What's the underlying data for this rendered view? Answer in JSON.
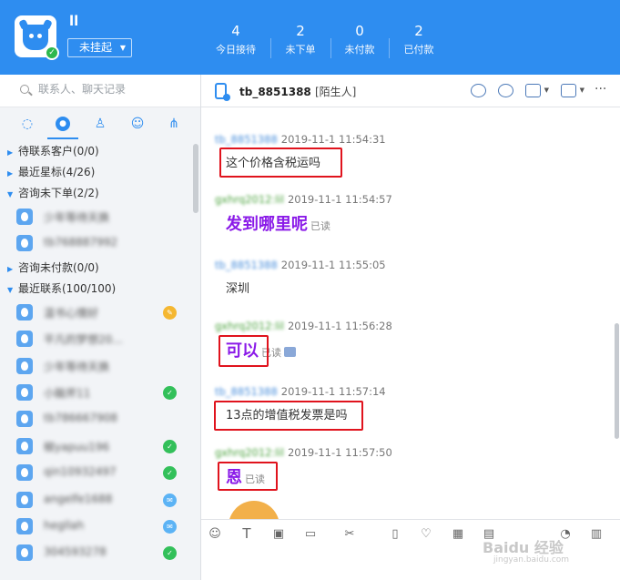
{
  "header": {
    "username": "ll",
    "status_label": "未挂起",
    "stats": [
      {
        "value": "4",
        "label": "今日接待"
      },
      {
        "value": "2",
        "label": "未下单"
      },
      {
        "value": "0",
        "label": "未付款"
      },
      {
        "value": "2",
        "label": "已付款"
      }
    ]
  },
  "sidebar": {
    "search_placeholder": "联系人、聊天记录",
    "tabs": [
      "chat-bubble-icon",
      "clock-icon",
      "person-icon",
      "people-icon",
      "org-chart-icon"
    ],
    "groups": [
      {
        "label": "待联系客户(0/0)",
        "expanded": false,
        "contacts": []
      },
      {
        "label": "最近星标(4/26)",
        "expanded": false,
        "contacts": []
      },
      {
        "label": "咨询未下单(2/2)",
        "expanded": true,
        "contacts": [
          {
            "name": "少年等待天换",
            "badge": ""
          },
          {
            "name": "tb768887992",
            "badge": ""
          }
        ]
      },
      {
        "label": "咨询未付款(0/0)",
        "expanded": false,
        "contacts": []
      },
      {
        "label": "最近联系(100/100)",
        "expanded": true,
        "contacts": [
          {
            "name": "温书心情好",
            "badge": "yellow"
          },
          {
            "name": "平凡的梦想20...",
            "badge": ""
          },
          {
            "name": "少年等待天换",
            "badge": ""
          },
          {
            "name": "小脑斧11",
            "badge": "green"
          },
          {
            "name": "tb786667908",
            "badge": ""
          },
          {
            "name": "椒yapuu196",
            "badge": "green"
          },
          {
            "name": "qin10932497",
            "badge": "green"
          },
          {
            "name": "angelfe1688",
            "badge": "blue"
          },
          {
            "name": "hegllah",
            "badge": "blue"
          },
          {
            "name": "304593278",
            "badge": "green"
          }
        ]
      }
    ]
  },
  "chat": {
    "contact_name": "tb_8851388",
    "contact_tag": "[陌生人]",
    "messages": [
      {
        "sender": "tb_8851388",
        "time": "2019-11-1 11:54:31",
        "text": "这个价格含税运吗",
        "style": "plain",
        "read": ""
      },
      {
        "sender": "gxhrq2012:lil",
        "time": "2019-11-1 11:54:57",
        "text": "发到哪里呢",
        "style": "big",
        "read": "已读"
      },
      {
        "sender": "tb_8851388",
        "time": "2019-11-1 11:55:05",
        "text": "深圳",
        "style": "plain",
        "read": ""
      },
      {
        "sender": "gxhrq2012:lil",
        "time": "2019-11-1 11:56:28",
        "text": "可以",
        "style": "big",
        "read": "已读"
      },
      {
        "sender": "tb_8851388",
        "time": "2019-11-1 11:57:14",
        "text": "13点的增值税发票是吗",
        "style": "plain",
        "read": ""
      },
      {
        "sender": "gxhrq2012:lil",
        "time": "2019-11-1 11:57:50",
        "text": "恩",
        "style": "big",
        "read": "已读"
      }
    ]
  },
  "watermark": {
    "brand": "Baidu 经验",
    "url": "jingyan.baidu.com"
  }
}
